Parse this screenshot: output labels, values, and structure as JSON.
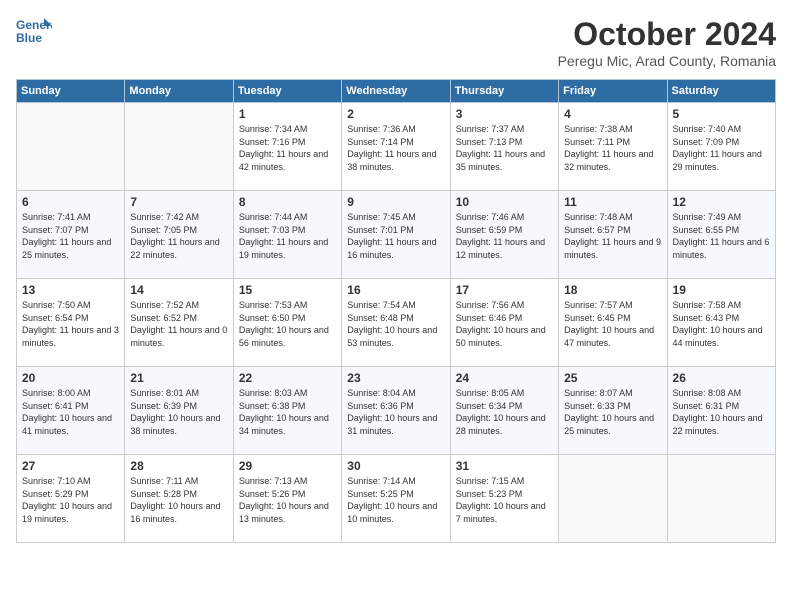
{
  "header": {
    "logo_line1": "General",
    "logo_line2": "Blue",
    "month": "October 2024",
    "location": "Peregu Mic, Arad County, Romania"
  },
  "weekdays": [
    "Sunday",
    "Monday",
    "Tuesday",
    "Wednesday",
    "Thursday",
    "Friday",
    "Saturday"
  ],
  "weeks": [
    [
      {
        "day": "",
        "info": ""
      },
      {
        "day": "",
        "info": ""
      },
      {
        "day": "1",
        "info": "Sunrise: 7:34 AM\nSunset: 7:16 PM\nDaylight: 11 hours and 42 minutes."
      },
      {
        "day": "2",
        "info": "Sunrise: 7:36 AM\nSunset: 7:14 PM\nDaylight: 11 hours and 38 minutes."
      },
      {
        "day": "3",
        "info": "Sunrise: 7:37 AM\nSunset: 7:13 PM\nDaylight: 11 hours and 35 minutes."
      },
      {
        "day": "4",
        "info": "Sunrise: 7:38 AM\nSunset: 7:11 PM\nDaylight: 11 hours and 32 minutes."
      },
      {
        "day": "5",
        "info": "Sunrise: 7:40 AM\nSunset: 7:09 PM\nDaylight: 11 hours and 29 minutes."
      }
    ],
    [
      {
        "day": "6",
        "info": "Sunrise: 7:41 AM\nSunset: 7:07 PM\nDaylight: 11 hours and 25 minutes."
      },
      {
        "day": "7",
        "info": "Sunrise: 7:42 AM\nSunset: 7:05 PM\nDaylight: 11 hours and 22 minutes."
      },
      {
        "day": "8",
        "info": "Sunrise: 7:44 AM\nSunset: 7:03 PM\nDaylight: 11 hours and 19 minutes."
      },
      {
        "day": "9",
        "info": "Sunrise: 7:45 AM\nSunset: 7:01 PM\nDaylight: 11 hours and 16 minutes."
      },
      {
        "day": "10",
        "info": "Sunrise: 7:46 AM\nSunset: 6:59 PM\nDaylight: 11 hours and 12 minutes."
      },
      {
        "day": "11",
        "info": "Sunrise: 7:48 AM\nSunset: 6:57 PM\nDaylight: 11 hours and 9 minutes."
      },
      {
        "day": "12",
        "info": "Sunrise: 7:49 AM\nSunset: 6:55 PM\nDaylight: 11 hours and 6 minutes."
      }
    ],
    [
      {
        "day": "13",
        "info": "Sunrise: 7:50 AM\nSunset: 6:54 PM\nDaylight: 11 hours and 3 minutes."
      },
      {
        "day": "14",
        "info": "Sunrise: 7:52 AM\nSunset: 6:52 PM\nDaylight: 11 hours and 0 minutes."
      },
      {
        "day": "15",
        "info": "Sunrise: 7:53 AM\nSunset: 6:50 PM\nDaylight: 10 hours and 56 minutes."
      },
      {
        "day": "16",
        "info": "Sunrise: 7:54 AM\nSunset: 6:48 PM\nDaylight: 10 hours and 53 minutes."
      },
      {
        "day": "17",
        "info": "Sunrise: 7:56 AM\nSunset: 6:46 PM\nDaylight: 10 hours and 50 minutes."
      },
      {
        "day": "18",
        "info": "Sunrise: 7:57 AM\nSunset: 6:45 PM\nDaylight: 10 hours and 47 minutes."
      },
      {
        "day": "19",
        "info": "Sunrise: 7:58 AM\nSunset: 6:43 PM\nDaylight: 10 hours and 44 minutes."
      }
    ],
    [
      {
        "day": "20",
        "info": "Sunrise: 8:00 AM\nSunset: 6:41 PM\nDaylight: 10 hours and 41 minutes."
      },
      {
        "day": "21",
        "info": "Sunrise: 8:01 AM\nSunset: 6:39 PM\nDaylight: 10 hours and 38 minutes."
      },
      {
        "day": "22",
        "info": "Sunrise: 8:03 AM\nSunset: 6:38 PM\nDaylight: 10 hours and 34 minutes."
      },
      {
        "day": "23",
        "info": "Sunrise: 8:04 AM\nSunset: 6:36 PM\nDaylight: 10 hours and 31 minutes."
      },
      {
        "day": "24",
        "info": "Sunrise: 8:05 AM\nSunset: 6:34 PM\nDaylight: 10 hours and 28 minutes."
      },
      {
        "day": "25",
        "info": "Sunrise: 8:07 AM\nSunset: 6:33 PM\nDaylight: 10 hours and 25 minutes."
      },
      {
        "day": "26",
        "info": "Sunrise: 8:08 AM\nSunset: 6:31 PM\nDaylight: 10 hours and 22 minutes."
      }
    ],
    [
      {
        "day": "27",
        "info": "Sunrise: 7:10 AM\nSunset: 5:29 PM\nDaylight: 10 hours and 19 minutes."
      },
      {
        "day": "28",
        "info": "Sunrise: 7:11 AM\nSunset: 5:28 PM\nDaylight: 10 hours and 16 minutes."
      },
      {
        "day": "29",
        "info": "Sunrise: 7:13 AM\nSunset: 5:26 PM\nDaylight: 10 hours and 13 minutes."
      },
      {
        "day": "30",
        "info": "Sunrise: 7:14 AM\nSunset: 5:25 PM\nDaylight: 10 hours and 10 minutes."
      },
      {
        "day": "31",
        "info": "Sunrise: 7:15 AM\nSunset: 5:23 PM\nDaylight: 10 hours and 7 minutes."
      },
      {
        "day": "",
        "info": ""
      },
      {
        "day": "",
        "info": ""
      }
    ]
  ]
}
